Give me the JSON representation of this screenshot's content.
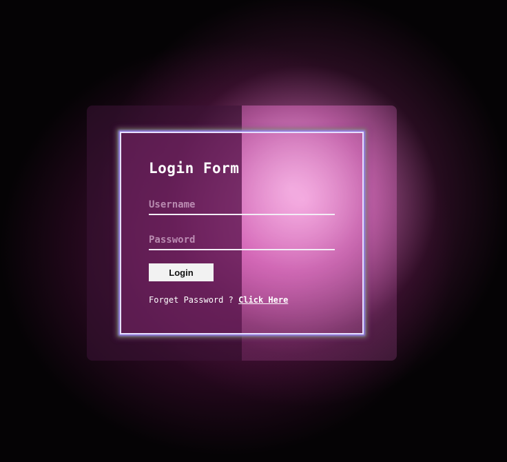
{
  "login_form": {
    "title": "Login Form",
    "username_placeholder": "Username",
    "password_placeholder": "Password",
    "login_label": "Login",
    "forgot_prefix": "Forget Password ?",
    "forgot_link": "Click Here"
  },
  "colors": {
    "background": "#000000",
    "glow_pink": "#e879c8",
    "frame_border": "#e6e0ff",
    "button_bg": "#f2f2f2",
    "text": "#ffffff"
  }
}
